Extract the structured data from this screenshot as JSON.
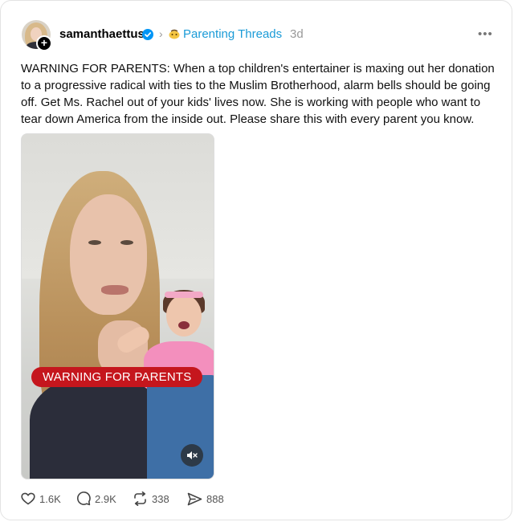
{
  "post": {
    "username": "samanthaettus",
    "community": "Parenting Threads",
    "time": "3d",
    "more": "•••",
    "follow": "+",
    "text": "WARNING FOR PARENTS: When a top children's entertainer is maxing out her donation to a progressive radical with ties to the Muslim Brotherhood, alarm bells should be going off. Get Ms. Rachel out of your kids' lives now. She is working with people who want to tear down America from the inside out. Please share this with every parent you know.",
    "media": {
      "banner": "WARNING FOR PARENTS",
      "muted": true
    },
    "stats": {
      "likes": "1.6K",
      "replies": "2.9K",
      "reposts": "338",
      "shares": "888"
    }
  },
  "icons": {
    "verified": "verified-badge-icon",
    "chevron": "chevron-right-icon",
    "community": "community-emoji-icon",
    "more": "more-dots-icon",
    "mute": "muted-speaker-icon",
    "like": "heart-icon",
    "reply": "comment-bubble-icon",
    "repost": "repost-icon",
    "share": "send-icon"
  },
  "colors": {
    "community_link": "#1b9bd7",
    "verified": "#0095f6",
    "banner": "#c5161d",
    "meta_gray": "#999999"
  }
}
